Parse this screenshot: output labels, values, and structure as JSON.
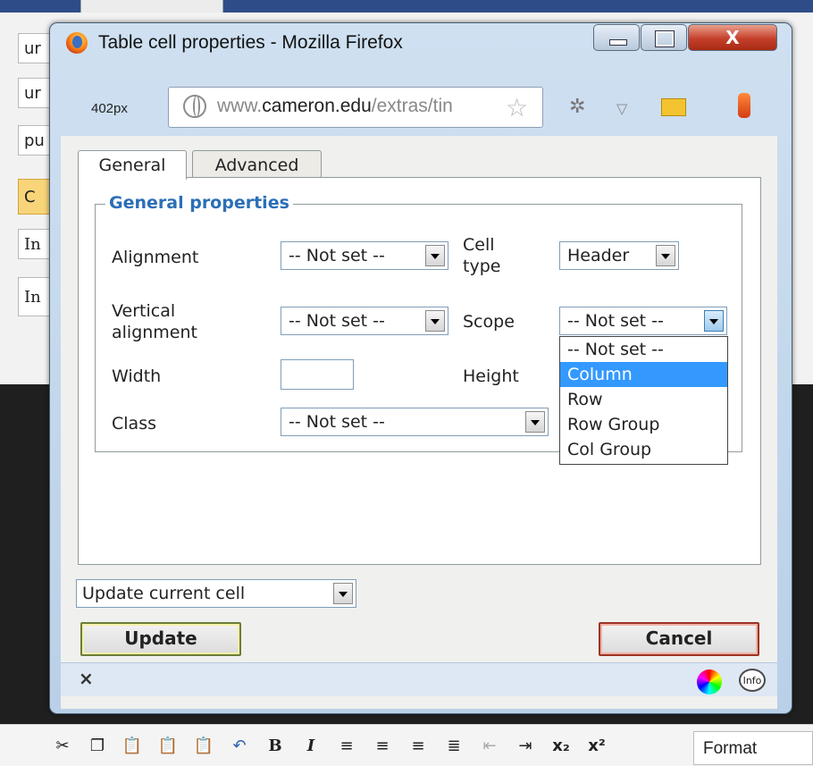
{
  "background": {
    "tabs": [
      "ur",
      "ur",
      "pu",
      "C",
      "In",
      "In"
    ]
  },
  "window": {
    "title": "Table cell properties - Mozilla Firefox",
    "close_label": "X",
    "size_label": "402px",
    "url_host": "www.",
    "url_domain": "cameron.edu",
    "url_path": "/extras/tin"
  },
  "tabs": [
    {
      "label": "General",
      "active": true
    },
    {
      "label": "Advanced",
      "active": false
    }
  ],
  "general": {
    "legend": "General properties",
    "alignment_label": "Alignment",
    "alignment_value": "-- Not set --",
    "cell_type_label": "Cell type",
    "cell_type_value": "Header",
    "valign_label": "Vertical alignment",
    "valign_value": "-- Not set --",
    "scope_label": "Scope",
    "scope_value": "-- Not set --",
    "width_label": "Width",
    "width_value": "",
    "height_label": "Height",
    "class_label": "Class",
    "class_value": "-- Not set --"
  },
  "scope_dropdown": {
    "options": [
      "-- Not set --",
      "Column",
      "Row",
      "Row Group",
      "Col Group"
    ],
    "highlighted": "Column"
  },
  "action_select": "Update current cell",
  "buttons": {
    "update": "Update",
    "cancel": "Cancel"
  },
  "status": {
    "close": "×",
    "info": "Info"
  },
  "editor_toolbar": {
    "format_label": "Format"
  }
}
